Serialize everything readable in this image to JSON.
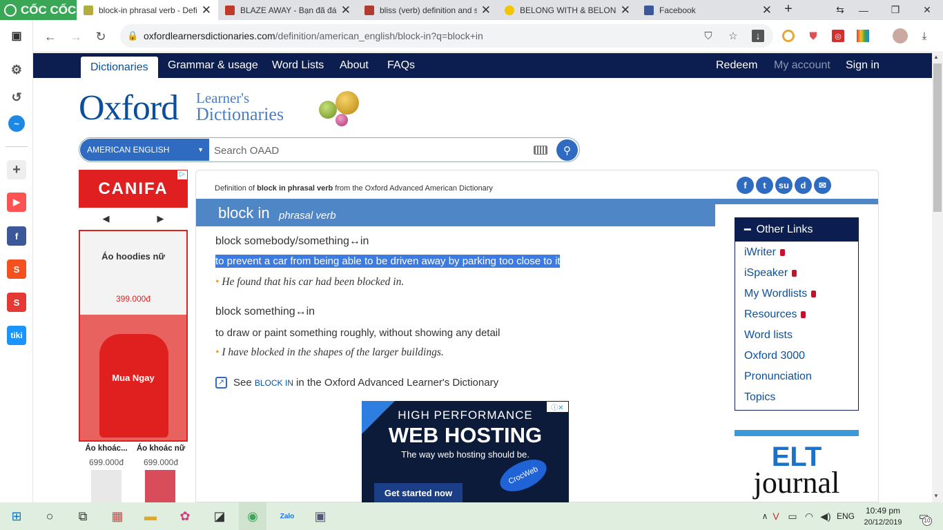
{
  "browser": {
    "brand": "CỐC CỐC",
    "tabs": [
      {
        "title": "block-in phrasal verb - Defi",
        "active": true
      },
      {
        "title": "BLAZE AWAY - Bạn đã đánh"
      },
      {
        "title": "bliss (verb) definition and sy"
      },
      {
        "title": "BELONG WITH & BELONG T"
      },
      {
        "title": "Facebook"
      }
    ],
    "url_host": "oxfordlearnersdictionaries.com",
    "url_path": "/definition/american_english/block-in?q=block+in"
  },
  "site_nav": {
    "left": [
      "Dictionaries",
      "Grammar & usage",
      "Word Lists",
      "About",
      "FAQs"
    ],
    "right": [
      "Redeem",
      "My account",
      "Sign in"
    ]
  },
  "logo": {
    "oxford": "Oxford",
    "learners": "Learner's",
    "dictionaries": "Dictionaries"
  },
  "search": {
    "dictionary": "AMERICAN ENGLISH",
    "placeholder": "Search OAAD"
  },
  "ad_left": {
    "brand": "CANIFA",
    "prev": "◀",
    "next": "▶",
    "product": "Áo hoodies nữ",
    "price": "399.000đ",
    "cta": "Mua Ngay",
    "items": [
      {
        "name": "Áo khoác...",
        "price": "699.000đ"
      },
      {
        "name": "Áo khoác nữ",
        "price": "699.000đ"
      }
    ]
  },
  "entry": {
    "source_prefix": "Definition of ",
    "source_bold": "block in phrasal verb",
    "source_suffix": " from the Oxford Advanced American Dictionary",
    "headword": "block in",
    "pos": "phrasal verb",
    "senses": [
      {
        "pattern": "block somebody/something↔in",
        "definition": "to prevent a car from being able to be driven away by parking too close to it",
        "example": "He found that his car had been blocked in."
      },
      {
        "pattern": "block something↔in",
        "definition": "to draw or paint something roughly, without showing any detail",
        "example": "I have blocked in the shapes of the larger buildings."
      }
    ],
    "see_prefix": "See ",
    "see_link": "BLOCK IN",
    "see_suffix": " in the Oxford Advanced Learner's Dictionary"
  },
  "other_links": {
    "title": "Other Links",
    "items": [
      "iWriter",
      "iSpeaker",
      "My Wordlists",
      "Resources",
      "Word lists",
      "Oxford 3000",
      "Pronunciation",
      "Topics"
    ]
  },
  "elt": {
    "line1": "ELT",
    "line2": "journal"
  },
  "ad_center": {
    "line1": "HIGH PERFORMANCE",
    "line2": "WEB HOSTING",
    "line3": "The way web hosting should be.",
    "cta": "Get started now",
    "brand": "CrocWeb"
  },
  "taskbar": {
    "lang": "ENG",
    "time": "10:49 pm",
    "date": "20/12/2019",
    "notif": "10"
  },
  "colors": {
    "navy": "#0b1e4f",
    "oxford_blue": "#0b4f9c",
    "band": "#4f86c6",
    "highlight": "#3d7be0"
  }
}
